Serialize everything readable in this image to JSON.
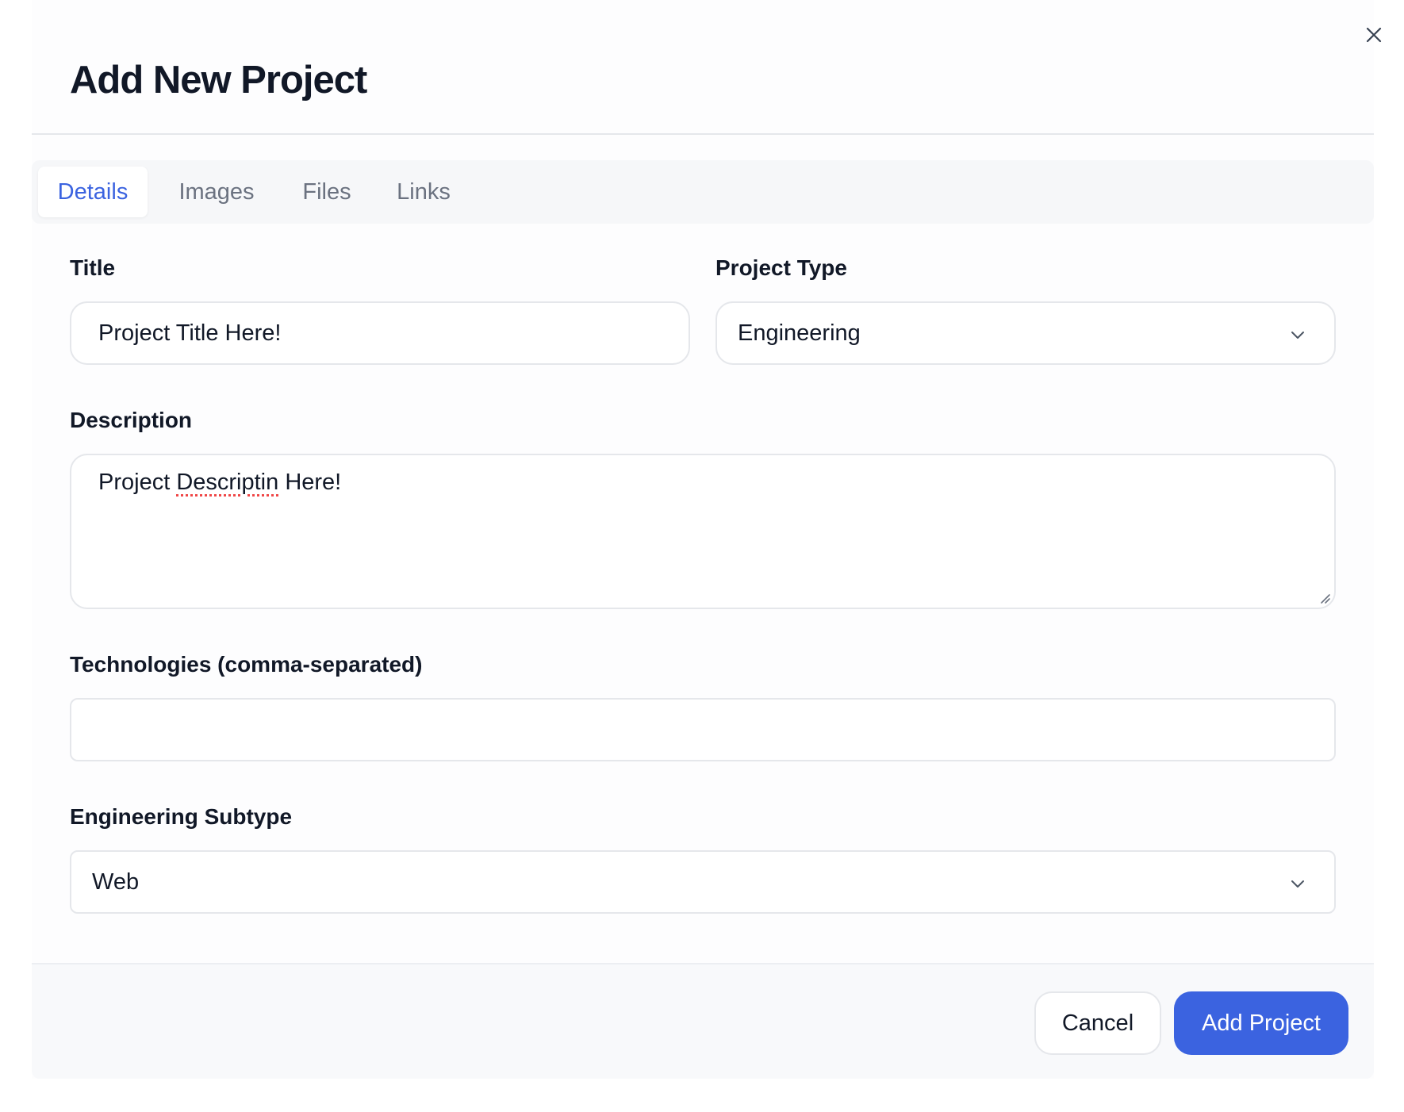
{
  "dialog": {
    "title": "Add New Project"
  },
  "tabs": [
    {
      "label": "Details",
      "active": true
    },
    {
      "label": "Images",
      "active": false
    },
    {
      "label": "Files",
      "active": false
    },
    {
      "label": "Links",
      "active": false
    }
  ],
  "form": {
    "title": {
      "label": "Title",
      "value": "Project Title Here!"
    },
    "project_type": {
      "label": "Project Type",
      "value": "Engineering"
    },
    "description": {
      "label": "Description",
      "value_prefix": "Project ",
      "value_misspelled": "Descriptin",
      "value_suffix": " Here!"
    },
    "technologies": {
      "label": "Technologies (comma-separated)",
      "value": ""
    },
    "engineering_subtype": {
      "label": "Engineering Subtype",
      "value": "Web"
    }
  },
  "footer": {
    "cancel_label": "Cancel",
    "submit_label": "Add Project"
  },
  "colors": {
    "accent": "#3b63e0",
    "border": "#e5e7eb",
    "tab_inactive": "#6b7280",
    "spellcheck": "#ef4444"
  },
  "icons": {
    "close": "close-icon",
    "chevron": "chevron-down-icon",
    "resize": "resize-handle-icon"
  }
}
